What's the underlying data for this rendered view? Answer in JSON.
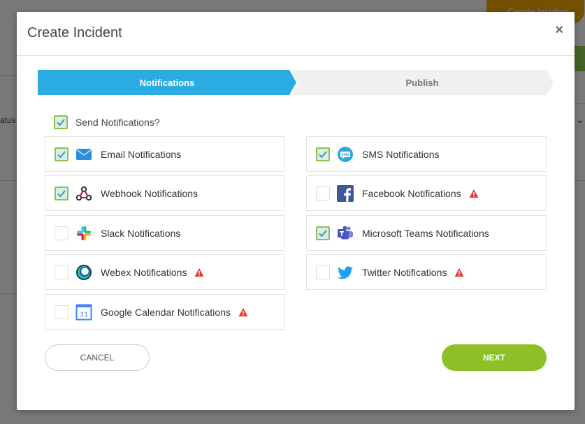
{
  "background": {
    "create_button_label": "Create Incident",
    "status_text": "atus"
  },
  "modal": {
    "title": "Create Incident",
    "close_symbol": "×"
  },
  "stepper": {
    "steps": [
      {
        "label": "Notifications",
        "active": true
      },
      {
        "label": "Publish",
        "active": false
      }
    ]
  },
  "send_notifications": {
    "label": "Send Notifications?",
    "checked": true
  },
  "notifications": [
    {
      "label": "Email Notifications",
      "checked": true,
      "icon": "email-icon",
      "warning": false
    },
    {
      "label": "SMS Notifications",
      "checked": true,
      "icon": "sms-icon",
      "warning": false
    },
    {
      "label": "Webhook Notifications",
      "checked": true,
      "icon": "webhook-icon",
      "warning": false
    },
    {
      "label": "Facebook Notifications",
      "checked": false,
      "icon": "facebook-icon",
      "warning": true
    },
    {
      "label": "Slack Notifications",
      "checked": false,
      "icon": "slack-icon",
      "warning": false
    },
    {
      "label": "Microsoft Teams Notifications",
      "checked": true,
      "icon": "teams-icon",
      "warning": false
    },
    {
      "label": "Webex Notifications",
      "checked": false,
      "icon": "webex-icon",
      "warning": true
    },
    {
      "label": "Twitter Notifications",
      "checked": false,
      "icon": "twitter-icon",
      "warning": true
    },
    {
      "label": "Google Calendar Notifications",
      "checked": false,
      "icon": "google-calendar-icon",
      "warning": true
    }
  ],
  "calendar_day": "31",
  "sms_badge": "SMS",
  "buttons": {
    "cancel": "CANCEL",
    "next": "NEXT"
  },
  "colors": {
    "accent_blue": "#2aace2",
    "green": "#8dbf26",
    "warning_red": "#e53935"
  }
}
